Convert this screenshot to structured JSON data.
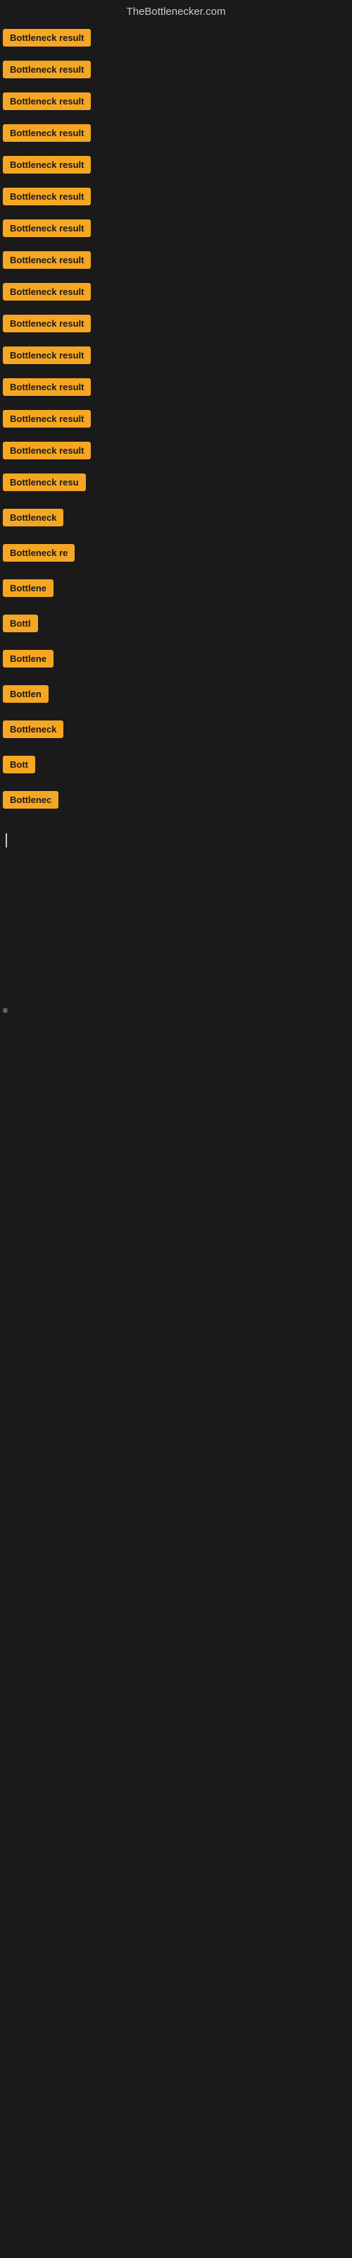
{
  "header": {
    "title": "TheBottlenecker.com"
  },
  "badge": {
    "label": "Bottleneck result",
    "bg_color": "#f5a623"
  },
  "items": [
    {
      "id": 1,
      "text": "Bottleneck result",
      "width_class": "badge-full"
    },
    {
      "id": 2,
      "text": "Bottleneck result",
      "width_class": "badge-full"
    },
    {
      "id": 3,
      "text": "Bottleneck result",
      "width_class": "badge-full"
    },
    {
      "id": 4,
      "text": "Bottleneck result",
      "width_class": "badge-full"
    },
    {
      "id": 5,
      "text": "Bottleneck result",
      "width_class": "badge-full"
    },
    {
      "id": 6,
      "text": "Bottleneck result",
      "width_class": "badge-full"
    },
    {
      "id": 7,
      "text": "Bottleneck result",
      "width_class": "badge-full"
    },
    {
      "id": 8,
      "text": "Bottleneck result",
      "width_class": "badge-full"
    },
    {
      "id": 9,
      "text": "Bottleneck result",
      "width_class": "badge-full"
    },
    {
      "id": 10,
      "text": "Bottleneck result",
      "width_class": "badge-full"
    },
    {
      "id": 11,
      "text": "Bottleneck result",
      "width_class": "badge-full"
    },
    {
      "id": 12,
      "text": "Bottleneck result",
      "width_class": "badge-full"
    },
    {
      "id": 13,
      "text": "Bottleneck result",
      "width_class": "badge-full"
    },
    {
      "id": 14,
      "text": "Bottleneck result",
      "width_class": "badge-full"
    },
    {
      "id": 15,
      "text": "Bottleneck resu",
      "width_class": "badge-w1"
    },
    {
      "id": 16,
      "text": "Bottleneck",
      "width_class": "badge-w4"
    },
    {
      "id": 17,
      "text": "Bottleneck re",
      "width_class": "badge-w2"
    },
    {
      "id": 18,
      "text": "Bottlene",
      "width_class": "badge-w5"
    },
    {
      "id": 19,
      "text": "Bottl",
      "width_class": "badge-w8"
    },
    {
      "id": 20,
      "text": "Bottlene",
      "width_class": "badge-w5"
    },
    {
      "id": 21,
      "text": "Bottlen",
      "width_class": "badge-w6"
    },
    {
      "id": 22,
      "text": "Bottleneck",
      "width_class": "badge-w4"
    },
    {
      "id": 23,
      "text": "Bott",
      "width_class": "badge-w9"
    },
    {
      "id": 24,
      "text": "Bottlenec",
      "width_class": "badge-w5"
    }
  ],
  "footer": {
    "cursor_visible": true,
    "small_text": "≡"
  }
}
